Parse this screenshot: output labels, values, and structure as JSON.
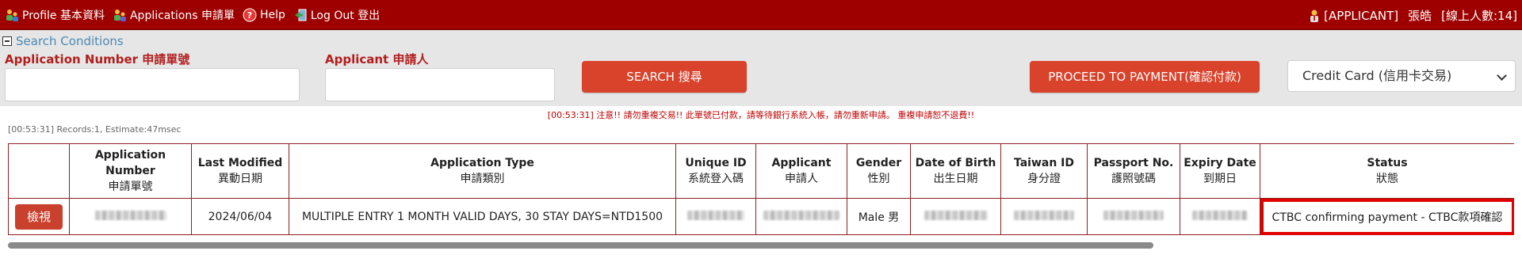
{
  "nav": {
    "profile": "Profile 基本資料",
    "applications": "Applications 申請單",
    "help": "Help",
    "logout": "Log Out 登出"
  },
  "user": {
    "role": "[APPLICANT]",
    "name": "張皓",
    "online": "[線上人數:14]"
  },
  "search": {
    "toggle_label": "Search Conditions",
    "app_number_label": "Application Number 申請單號",
    "applicant_label": "Applicant 申請人",
    "search_button": "SEARCH 搜尋",
    "proceed_button": "PROCEED TO PAYMENT(確認付款)",
    "payment_method": "Credit Card (信用卡交易)"
  },
  "warning": "[00:53:31] 注意!! 請勿重複交易!! 此單號已付款，請等待銀行系統入帳，請勿重新申請。 重複申請恕不退費!!",
  "records": "[00:53:31] Records:1, Estimate:47msec",
  "table": {
    "headers": [
      {
        "en": "",
        "zh": ""
      },
      {
        "en": "Application Number",
        "zh": "申請單號"
      },
      {
        "en": "Last Modified",
        "zh": "異動日期"
      },
      {
        "en": "Application Type",
        "zh": "申請類別"
      },
      {
        "en": "Unique ID",
        "zh": "系統登入碼"
      },
      {
        "en": "Applicant",
        "zh": "申請人"
      },
      {
        "en": "Gender",
        "zh": "性別"
      },
      {
        "en": "Date of Birth",
        "zh": "出生日期"
      },
      {
        "en": "Taiwan ID",
        "zh": "身分證"
      },
      {
        "en": "Passport No.",
        "zh": "護照號碼"
      },
      {
        "en": "Expiry Date",
        "zh": "到期日"
      },
      {
        "en": "Status",
        "zh": "狀態"
      }
    ],
    "row": {
      "view_button": "檢視",
      "last_modified": "2024/06/04",
      "application_type": "MULTIPLE ENTRY 1 MONTH VALID DAYS, 30 STAY DAYS=NTD1500",
      "gender": "Male 男",
      "status": "CTBC confirming payment - CTBC款項確認"
    }
  },
  "colors": {
    "topbar": "#9e0000",
    "accent_button": "#d9422b",
    "label_red": "#b21e1e",
    "link_blue": "#4a89b5",
    "status_highlight": "#e00000"
  },
  "icons": [
    "profile-icon",
    "applications-icon",
    "help-icon",
    "logout-icon",
    "user-icon"
  ]
}
